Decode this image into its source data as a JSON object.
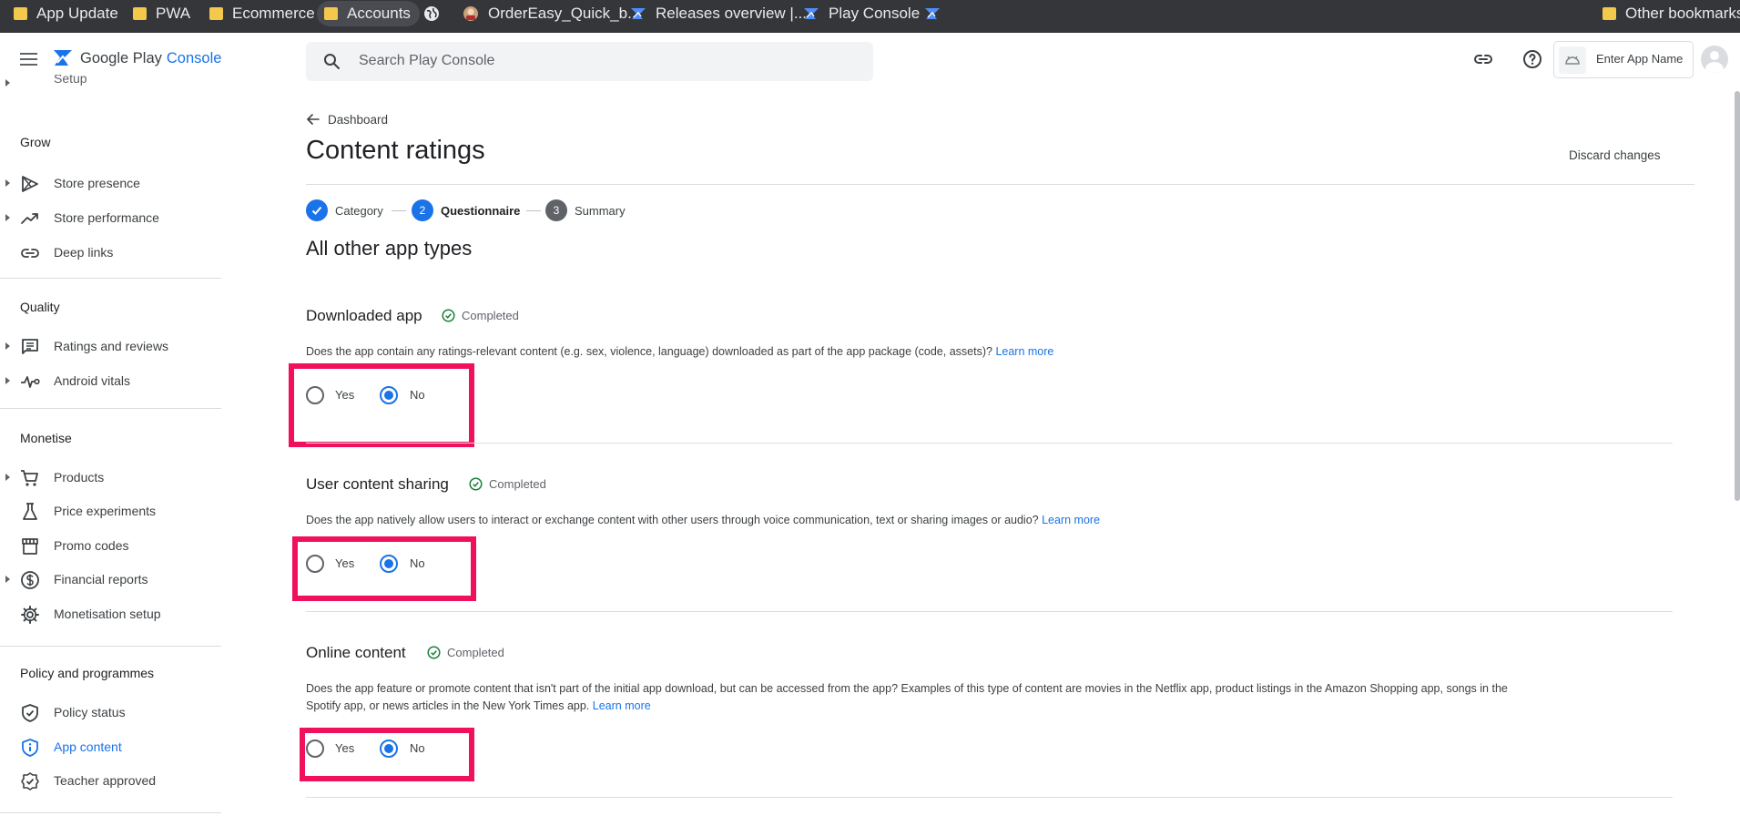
{
  "bookmarks": [
    {
      "label": "App Update",
      "icon": "folder-icon"
    },
    {
      "label": "PWA",
      "icon": "folder-icon"
    },
    {
      "label": "Ecommerce",
      "icon": "folder-icon"
    },
    {
      "label": "Accounts",
      "icon": "folder-icon"
    },
    {
      "label": "",
      "icon": "globe-icon"
    },
    {
      "label": "OrderEasy_Quick_b...",
      "icon": "app-favicon-icon"
    },
    {
      "label": "Releases overview |...",
      "icon": "play-console-icon"
    },
    {
      "label": "Play Console",
      "icon": "play-console-icon"
    },
    {
      "label": "",
      "icon": "play-console-icon"
    },
    {
      "label": "Other bookmarks",
      "icon": "folder-icon"
    }
  ],
  "header": {
    "brand_google": "Google Play",
    "brand_console": "Console",
    "search_placeholder": "Search Play Console",
    "app_picker_label": "Enter App Name"
  },
  "sidebar": {
    "top_partial_label": "Setup",
    "sections": [
      {
        "title": "Grow",
        "items": [
          "Store presence",
          "Store performance",
          "Deep links"
        ]
      },
      {
        "title": "Quality",
        "items": [
          "Ratings and reviews",
          "Android vitals"
        ]
      },
      {
        "title": "Monetise",
        "items": [
          "Products",
          "Price experiments",
          "Promo codes",
          "Financial reports",
          "Monetisation setup"
        ]
      },
      {
        "title": "Policy and programmes",
        "items": [
          "Policy status",
          "App content",
          "Teacher approved"
        ]
      }
    ],
    "active_item": "App content"
  },
  "main": {
    "back_label": "Dashboard",
    "page_title": "Content ratings",
    "discard_label": "Discard changes",
    "steps": [
      {
        "number": "",
        "label": "Category",
        "state": "done"
      },
      {
        "number": "2",
        "label": "Questionnaire",
        "state": "current"
      },
      {
        "number": "3",
        "label": "Summary",
        "state": "upcoming"
      }
    ],
    "section_title": "All other app types",
    "questions": [
      {
        "title": "Downloaded app",
        "status": "Completed",
        "text": "Does the app contain any ratings-relevant content (e.g. sex, violence, language) downloaded as part of the app package (code, assets)?",
        "text2": "",
        "link": "Learn more",
        "yes_label": "Yes",
        "no_label": "No",
        "selected": "No"
      },
      {
        "title": "User content sharing",
        "status": "Completed",
        "text": "Does the app natively allow users to interact or exchange content with other users through voice communication, text or sharing images or audio?",
        "text2": "",
        "link": "Learn more",
        "yes_label": "Yes",
        "no_label": "No",
        "selected": "No"
      },
      {
        "title": "Online content",
        "status": "Completed",
        "text": "Does the app feature or promote content that isn't part of the initial app download, but can be accessed from the app? Examples of this type of content are movies in the Netflix app, product listings in the Amazon Shopping app, songs in the",
        "text2": "Spotify app, or news articles in the New York Times app.",
        "link": "Learn more",
        "yes_label": "Yes",
        "no_label": "No",
        "selected": "No"
      }
    ]
  },
  "colors": {
    "accent": "#1a73e8",
    "highlight": "#f0105c",
    "completed_green": "#188038",
    "bookmark_bar": "#35363a"
  }
}
